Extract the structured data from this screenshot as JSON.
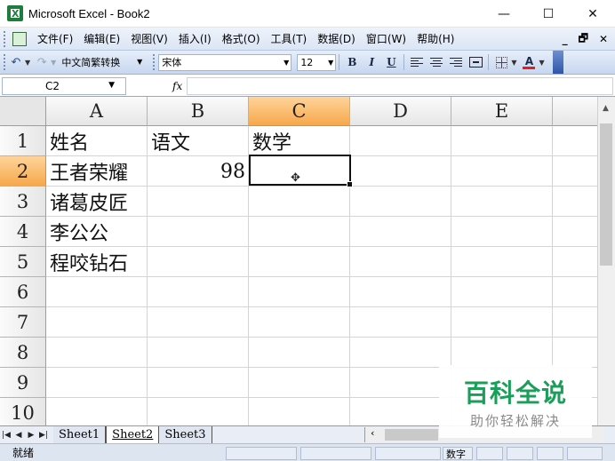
{
  "window": {
    "title": "Microsoft Excel - Book2",
    "minimize": "—",
    "maximize": "☐",
    "close": "✕"
  },
  "menu": {
    "items": [
      "文件(F)",
      "编辑(E)",
      "视图(V)",
      "插入(I)",
      "格式(O)",
      "工具(T)",
      "数据(D)",
      "窗口(W)",
      "帮助(H)"
    ],
    "doc_controls": [
      "_",
      "🗗",
      "✕"
    ]
  },
  "toolbar": {
    "undo_icon": "↶",
    "redo_icon": "↷",
    "conversion_label": "中文简繁转换",
    "font_name": "宋体",
    "font_size": "12",
    "bold": "B",
    "italic": "I",
    "underline": "U",
    "font_color_letter": "A"
  },
  "formula_bar": {
    "name_box": "C2",
    "fx": "fx",
    "value": ""
  },
  "columns": [
    "A",
    "B",
    "C",
    "D",
    "E"
  ],
  "rows": [
    "1",
    "2",
    "3",
    "4",
    "5",
    "6",
    "7",
    "8",
    "9",
    "10"
  ],
  "selected_cell": "C2",
  "cells": {
    "A1": "姓名",
    "B1": "语文",
    "C1": "数学",
    "A2": "王者荣耀",
    "B2": "98",
    "A3": "诸葛皮匠",
    "A4": "李公公",
    "A5": "程咬钻石"
  },
  "sheets": [
    "Sheet1",
    "Sheet2",
    "Sheet3"
  ],
  "active_sheet": "Sheet2",
  "status": {
    "ready": "就绪",
    "num_indicator": "数字"
  },
  "watermark": {
    "title": "百科全说",
    "subtitle": "助你轻松解决"
  },
  "colors": {
    "active_header": "#f6a84a",
    "watermark_green": "#1a9e5a"
  }
}
